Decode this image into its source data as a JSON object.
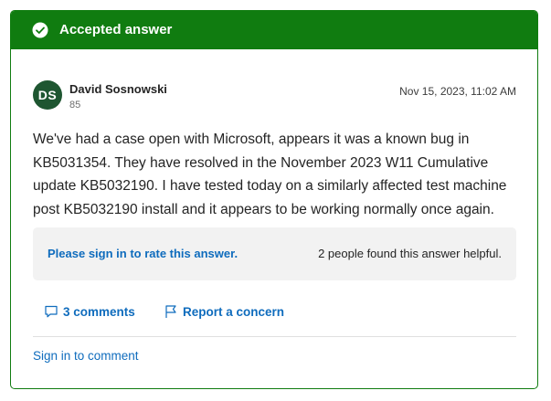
{
  "banner": {
    "title": "Accepted answer",
    "icon": "check-circle-icon",
    "color": "#107c10"
  },
  "author": {
    "initials": "DS",
    "name": "David Sosnowski",
    "reputation": "85",
    "avatar_color": "#1e5631"
  },
  "timestamp": "Nov 15, 2023, 11:02 AM",
  "answer": {
    "text": "We've had a case open with Microsoft, appears it was a known bug in KB5031354. They have resolved in the November 2023 W11 Cumulative update KB5032190. I have tested today on a similarly affected test machine post KB5032190 install and it appears to be working normally once again."
  },
  "rating": {
    "sign_in_label": "Please sign in to rate this answer.",
    "helpful_text": "2 people found this answer helpful."
  },
  "actions": {
    "comments_label": "3 comments",
    "comments_icon": "comment-icon",
    "report_label": "Report a concern",
    "report_icon": "flag-icon"
  },
  "footer": {
    "sign_in_comment": "Sign in to comment"
  },
  "colors": {
    "link": "#0f6cbd",
    "accent": "#107c10"
  }
}
